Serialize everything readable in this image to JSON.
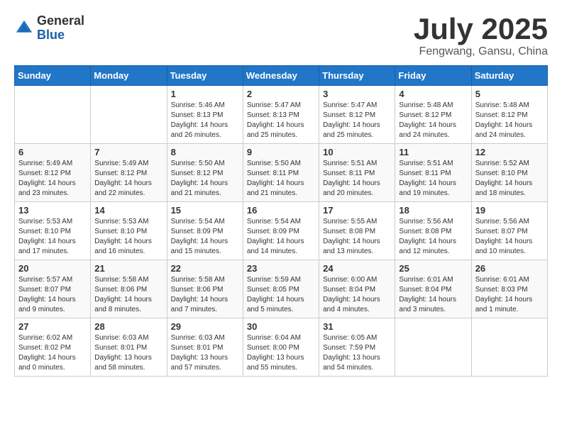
{
  "logo": {
    "general": "General",
    "blue": "Blue"
  },
  "title": {
    "month": "July 2025",
    "location": "Fengwang, Gansu, China"
  },
  "weekdays": [
    "Sunday",
    "Monday",
    "Tuesday",
    "Wednesday",
    "Thursday",
    "Friday",
    "Saturday"
  ],
  "weeks": [
    [
      {
        "day": "",
        "info": ""
      },
      {
        "day": "",
        "info": ""
      },
      {
        "day": "1",
        "info": "Sunrise: 5:46 AM\nSunset: 8:13 PM\nDaylight: 14 hours\nand 26 minutes."
      },
      {
        "day": "2",
        "info": "Sunrise: 5:47 AM\nSunset: 8:13 PM\nDaylight: 14 hours\nand 25 minutes."
      },
      {
        "day": "3",
        "info": "Sunrise: 5:47 AM\nSunset: 8:12 PM\nDaylight: 14 hours\nand 25 minutes."
      },
      {
        "day": "4",
        "info": "Sunrise: 5:48 AM\nSunset: 8:12 PM\nDaylight: 14 hours\nand 24 minutes."
      },
      {
        "day": "5",
        "info": "Sunrise: 5:48 AM\nSunset: 8:12 PM\nDaylight: 14 hours\nand 24 minutes."
      }
    ],
    [
      {
        "day": "6",
        "info": "Sunrise: 5:49 AM\nSunset: 8:12 PM\nDaylight: 14 hours\nand 23 minutes."
      },
      {
        "day": "7",
        "info": "Sunrise: 5:49 AM\nSunset: 8:12 PM\nDaylight: 14 hours\nand 22 minutes."
      },
      {
        "day": "8",
        "info": "Sunrise: 5:50 AM\nSunset: 8:12 PM\nDaylight: 14 hours\nand 21 minutes."
      },
      {
        "day": "9",
        "info": "Sunrise: 5:50 AM\nSunset: 8:11 PM\nDaylight: 14 hours\nand 21 minutes."
      },
      {
        "day": "10",
        "info": "Sunrise: 5:51 AM\nSunset: 8:11 PM\nDaylight: 14 hours\nand 20 minutes."
      },
      {
        "day": "11",
        "info": "Sunrise: 5:51 AM\nSunset: 8:11 PM\nDaylight: 14 hours\nand 19 minutes."
      },
      {
        "day": "12",
        "info": "Sunrise: 5:52 AM\nSunset: 8:10 PM\nDaylight: 14 hours\nand 18 minutes."
      }
    ],
    [
      {
        "day": "13",
        "info": "Sunrise: 5:53 AM\nSunset: 8:10 PM\nDaylight: 14 hours\nand 17 minutes."
      },
      {
        "day": "14",
        "info": "Sunrise: 5:53 AM\nSunset: 8:10 PM\nDaylight: 14 hours\nand 16 minutes."
      },
      {
        "day": "15",
        "info": "Sunrise: 5:54 AM\nSunset: 8:09 PM\nDaylight: 14 hours\nand 15 minutes."
      },
      {
        "day": "16",
        "info": "Sunrise: 5:54 AM\nSunset: 8:09 PM\nDaylight: 14 hours\nand 14 minutes."
      },
      {
        "day": "17",
        "info": "Sunrise: 5:55 AM\nSunset: 8:08 PM\nDaylight: 14 hours\nand 13 minutes."
      },
      {
        "day": "18",
        "info": "Sunrise: 5:56 AM\nSunset: 8:08 PM\nDaylight: 14 hours\nand 12 minutes."
      },
      {
        "day": "19",
        "info": "Sunrise: 5:56 AM\nSunset: 8:07 PM\nDaylight: 14 hours\nand 10 minutes."
      }
    ],
    [
      {
        "day": "20",
        "info": "Sunrise: 5:57 AM\nSunset: 8:07 PM\nDaylight: 14 hours\nand 9 minutes."
      },
      {
        "day": "21",
        "info": "Sunrise: 5:58 AM\nSunset: 8:06 PM\nDaylight: 14 hours\nand 8 minutes."
      },
      {
        "day": "22",
        "info": "Sunrise: 5:58 AM\nSunset: 8:06 PM\nDaylight: 14 hours\nand 7 minutes."
      },
      {
        "day": "23",
        "info": "Sunrise: 5:59 AM\nSunset: 8:05 PM\nDaylight: 14 hours\nand 5 minutes."
      },
      {
        "day": "24",
        "info": "Sunrise: 6:00 AM\nSunset: 8:04 PM\nDaylight: 14 hours\nand 4 minutes."
      },
      {
        "day": "25",
        "info": "Sunrise: 6:01 AM\nSunset: 8:04 PM\nDaylight: 14 hours\nand 3 minutes."
      },
      {
        "day": "26",
        "info": "Sunrise: 6:01 AM\nSunset: 8:03 PM\nDaylight: 14 hours\nand 1 minute."
      }
    ],
    [
      {
        "day": "27",
        "info": "Sunrise: 6:02 AM\nSunset: 8:02 PM\nDaylight: 14 hours\nand 0 minutes."
      },
      {
        "day": "28",
        "info": "Sunrise: 6:03 AM\nSunset: 8:01 PM\nDaylight: 13 hours\nand 58 minutes."
      },
      {
        "day": "29",
        "info": "Sunrise: 6:03 AM\nSunset: 8:01 PM\nDaylight: 13 hours\nand 57 minutes."
      },
      {
        "day": "30",
        "info": "Sunrise: 6:04 AM\nSunset: 8:00 PM\nDaylight: 13 hours\nand 55 minutes."
      },
      {
        "day": "31",
        "info": "Sunrise: 6:05 AM\nSunset: 7:59 PM\nDaylight: 13 hours\nand 54 minutes."
      },
      {
        "day": "",
        "info": ""
      },
      {
        "day": "",
        "info": ""
      }
    ]
  ]
}
